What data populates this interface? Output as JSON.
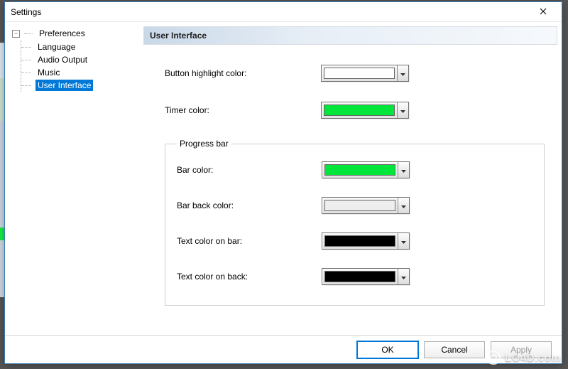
{
  "window": {
    "title": "Settings"
  },
  "tree": {
    "root": "Preferences",
    "items": [
      {
        "label": "Language"
      },
      {
        "label": "Audio Output"
      },
      {
        "label": "Music"
      },
      {
        "label": "User Interface",
        "selected": true
      }
    ]
  },
  "panel": {
    "heading": "User Interface",
    "fields": {
      "button_highlight": {
        "label": "Button highlight color:",
        "color": "#ffffff"
      },
      "timer_color": {
        "label": "Timer color:",
        "color": "#00e63a"
      }
    },
    "group": {
      "legend": "Progress bar",
      "fields": {
        "bar_color": {
          "label": "Bar color:",
          "color": "#00e63a"
        },
        "bar_back_color": {
          "label": "Bar back color:",
          "color": "#eeeeee"
        },
        "text_on_bar": {
          "label": "Text color on bar:",
          "color": "#000000"
        },
        "text_on_back": {
          "label": "Text color on back:",
          "color": "#000000"
        }
      }
    }
  },
  "buttons": {
    "ok": "OK",
    "cancel": "Cancel",
    "apply": "Apply"
  },
  "watermark": "LO4D.com"
}
